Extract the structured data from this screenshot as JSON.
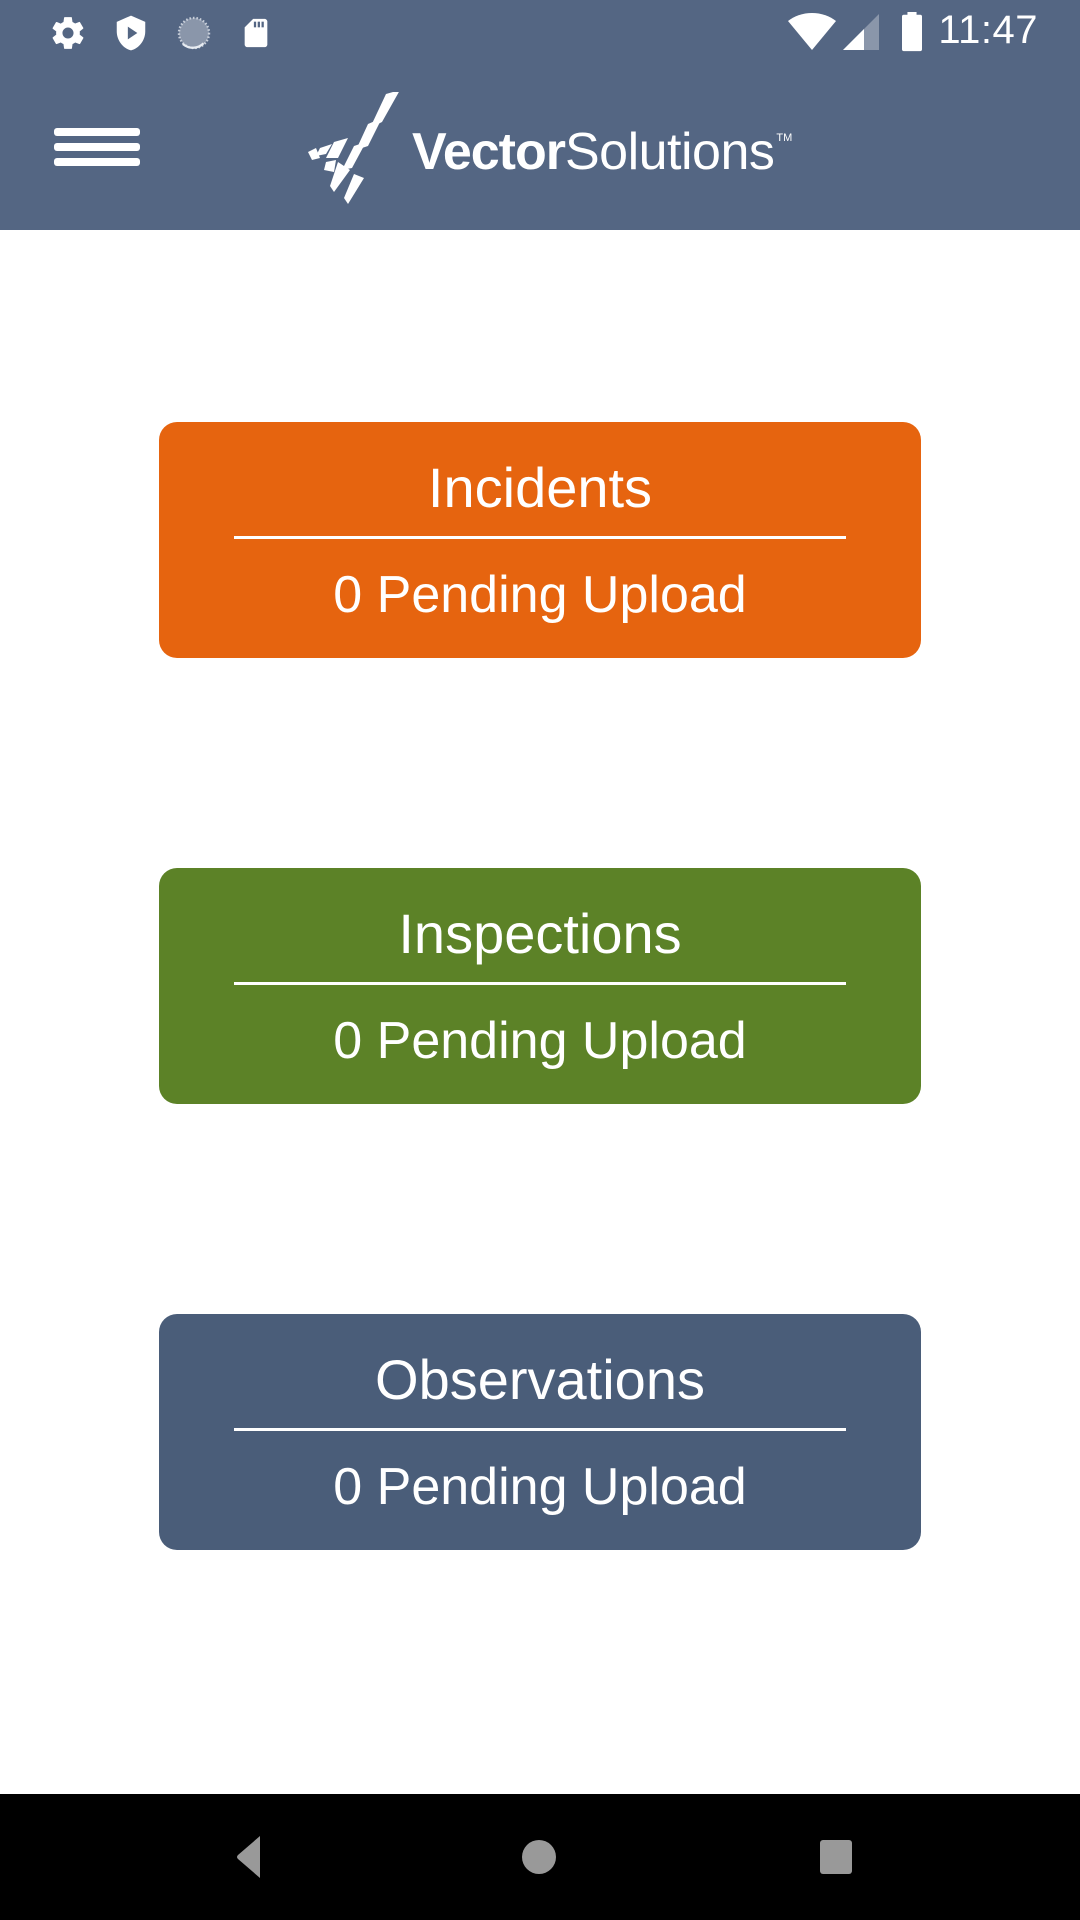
{
  "status_bar": {
    "time": "11:47",
    "left_icons": [
      "gear-icon",
      "shield-play-icon",
      "sync-progress-icon",
      "sd-card-icon"
    ],
    "right_icons": [
      "wifi-icon",
      "cell-signal-icon",
      "battery-icon"
    ]
  },
  "header": {
    "menu_icon": "hamburger-menu-icon",
    "logo": {
      "bold": "Vector",
      "light": "Solutions",
      "trademark": "TM"
    },
    "background_color": "#546683"
  },
  "cards": [
    {
      "title": "Incidents",
      "subtitle": "0 Pending Upload",
      "pending_count": 0,
      "color": "#E6640F"
    },
    {
      "title": "Inspections",
      "subtitle": "0 Pending Upload",
      "pending_count": 0,
      "color": "#5C8227"
    },
    {
      "title": "Observations",
      "subtitle": "0 Pending Upload",
      "pending_count": 0,
      "color": "#4A5D79"
    }
  ],
  "nav_bar": {
    "buttons": [
      "back-icon",
      "home-icon",
      "recents-icon"
    ]
  }
}
